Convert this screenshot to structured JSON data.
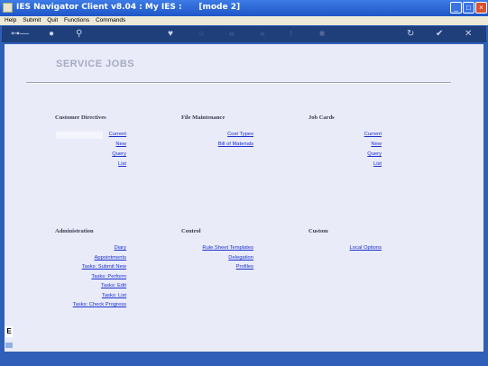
{
  "window": {
    "title": "IES Navigator Client v8.04 : My IES :      [mode 2]"
  },
  "menu": [
    "Help",
    "Submit",
    "Quit",
    "Functions",
    "Commands"
  ],
  "toolbar_icons": [
    "key-icon",
    "info-icon",
    "search-icon",
    "heart-icon",
    "circle-icon",
    "back-icon",
    "forward-icon",
    "upload-icon",
    "stop-icon",
    "refresh-icon",
    "check-icon",
    "close-icon"
  ],
  "page": {
    "title": "SERVICE JOBS"
  },
  "sections": {
    "customer_directives": {
      "heading": "Customer Directives",
      "links": [
        "Current",
        "New",
        "Query",
        "List"
      ]
    },
    "file_maintenance": {
      "heading": "File Maintenance",
      "links": [
        "Cost Types",
        "Bill of Materials"
      ]
    },
    "job_cards": {
      "heading": "Job Cards",
      "links": [
        "Current",
        "New",
        "Query",
        "List"
      ]
    },
    "administration": {
      "heading": "Administration",
      "links": [
        "Diary",
        "Appointments",
        "Tasks: Submit New",
        "Tasks: Perform",
        "Tasks: Edit",
        "Tasks: List",
        "Tasks: Check Progress"
      ]
    },
    "control": {
      "heading": "Control",
      "links": [
        "Rule Sheet Templates",
        "Delegation",
        "Profiles"
      ]
    },
    "custom": {
      "heading": "Custom",
      "links": [
        "Local Options"
      ]
    }
  },
  "side": {
    "icon_letter": "E"
  }
}
